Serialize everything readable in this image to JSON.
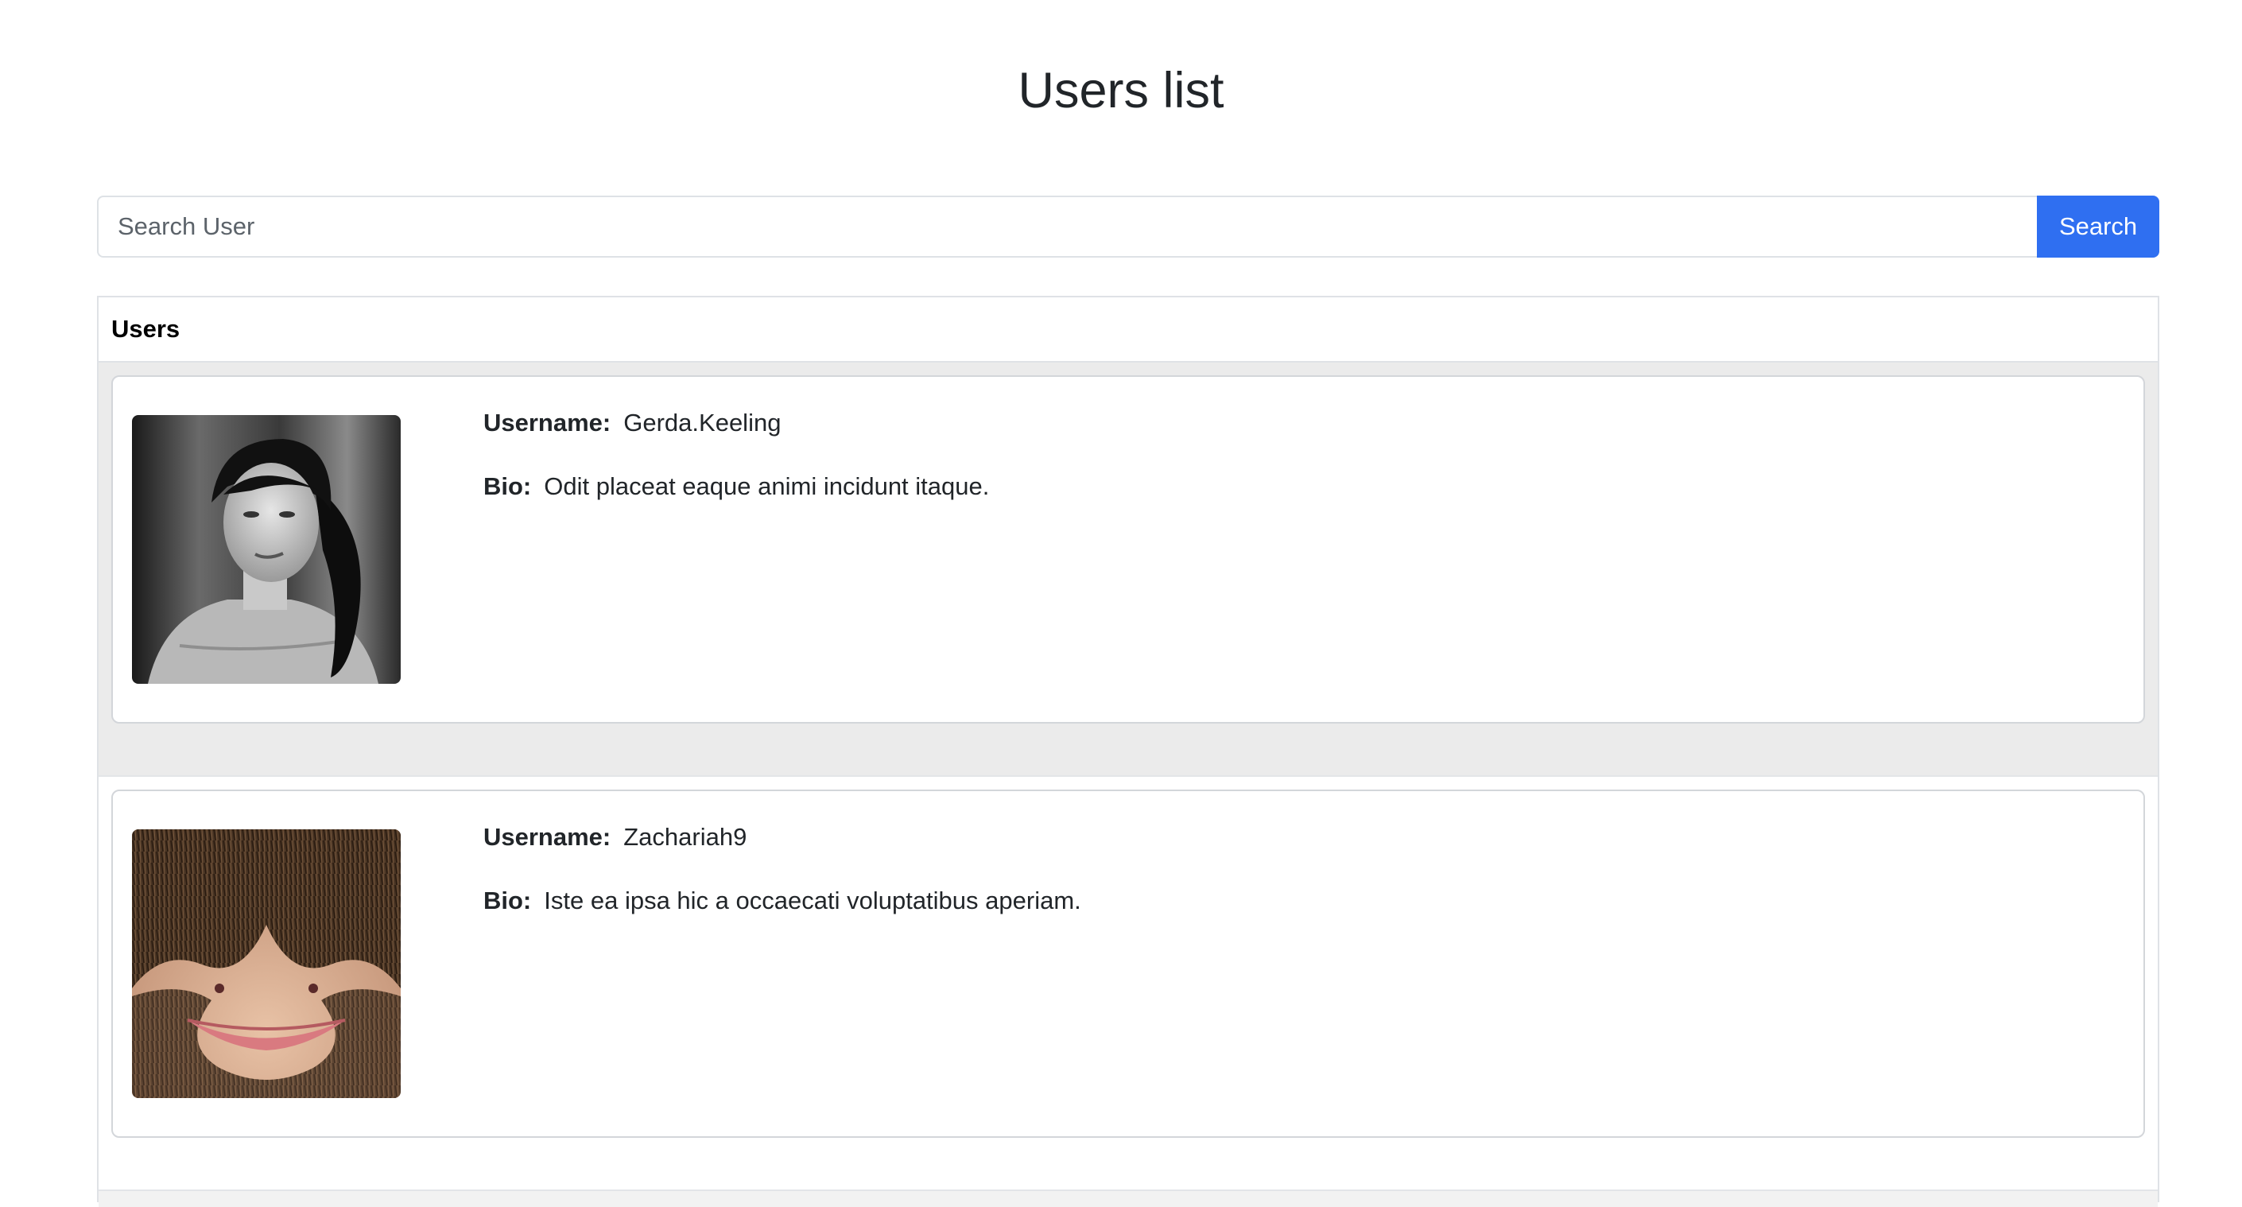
{
  "header": {
    "title": "Users list"
  },
  "search": {
    "placeholder": "Search User",
    "value": "",
    "button_label": "Search",
    "button_color": "#2f6ff1"
  },
  "users_panel": {
    "title": "Users",
    "username_label": "Username:",
    "bio_label": "Bio:",
    "users": [
      {
        "username": "Gerda.Keeling",
        "bio": "Odit placeat eaque animi incidunt itaque.",
        "avatar": "woman-portrait-photo"
      },
      {
        "username": "Zachariah9",
        "bio": "Iste ea ipsa hic a occaecati voluptatibus aperiam.",
        "avatar": "beard-face-photo"
      }
    ]
  }
}
